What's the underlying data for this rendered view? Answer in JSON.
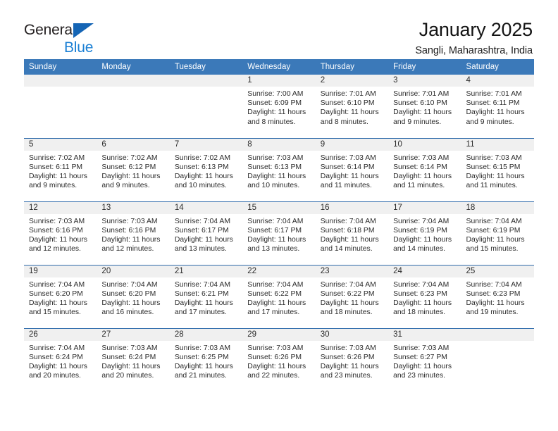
{
  "brand": {
    "name_part1": "General",
    "name_part2": "Blue",
    "accent_color": "#1a7fd4",
    "triangle_color": "#1565b5",
    "triangle_icon": "triangle-icon"
  },
  "header": {
    "title": "January 2025",
    "subtitle": "Sangli, Maharashtra, India"
  },
  "calendar": {
    "header_bg": "#3b79b9",
    "row_border_color": "#2f6bab",
    "daynum_band_bg": "#f0f0f0",
    "weekdays": [
      "Sunday",
      "Monday",
      "Tuesday",
      "Wednesday",
      "Thursday",
      "Friday",
      "Saturday"
    ],
    "weeks": [
      [
        {
          "day": "",
          "sunrise": "",
          "sunset": "",
          "daylight_line1": "",
          "daylight_line2": ""
        },
        {
          "day": "",
          "sunrise": "",
          "sunset": "",
          "daylight_line1": "",
          "daylight_line2": ""
        },
        {
          "day": "",
          "sunrise": "",
          "sunset": "",
          "daylight_line1": "",
          "daylight_line2": ""
        },
        {
          "day": "1",
          "sunrise": "Sunrise: 7:00 AM",
          "sunset": "Sunset: 6:09 PM",
          "daylight_line1": "Daylight: 11 hours",
          "daylight_line2": "and 8 minutes."
        },
        {
          "day": "2",
          "sunrise": "Sunrise: 7:01 AM",
          "sunset": "Sunset: 6:10 PM",
          "daylight_line1": "Daylight: 11 hours",
          "daylight_line2": "and 8 minutes."
        },
        {
          "day": "3",
          "sunrise": "Sunrise: 7:01 AM",
          "sunset": "Sunset: 6:10 PM",
          "daylight_line1": "Daylight: 11 hours",
          "daylight_line2": "and 9 minutes."
        },
        {
          "day": "4",
          "sunrise": "Sunrise: 7:01 AM",
          "sunset": "Sunset: 6:11 PM",
          "daylight_line1": "Daylight: 11 hours",
          "daylight_line2": "and 9 minutes."
        }
      ],
      [
        {
          "day": "5",
          "sunrise": "Sunrise: 7:02 AM",
          "sunset": "Sunset: 6:11 PM",
          "daylight_line1": "Daylight: 11 hours",
          "daylight_line2": "and 9 minutes."
        },
        {
          "day": "6",
          "sunrise": "Sunrise: 7:02 AM",
          "sunset": "Sunset: 6:12 PM",
          "daylight_line1": "Daylight: 11 hours",
          "daylight_line2": "and 9 minutes."
        },
        {
          "day": "7",
          "sunrise": "Sunrise: 7:02 AM",
          "sunset": "Sunset: 6:13 PM",
          "daylight_line1": "Daylight: 11 hours",
          "daylight_line2": "and 10 minutes."
        },
        {
          "day": "8",
          "sunrise": "Sunrise: 7:03 AM",
          "sunset": "Sunset: 6:13 PM",
          "daylight_line1": "Daylight: 11 hours",
          "daylight_line2": "and 10 minutes."
        },
        {
          "day": "9",
          "sunrise": "Sunrise: 7:03 AM",
          "sunset": "Sunset: 6:14 PM",
          "daylight_line1": "Daylight: 11 hours",
          "daylight_line2": "and 11 minutes."
        },
        {
          "day": "10",
          "sunrise": "Sunrise: 7:03 AM",
          "sunset": "Sunset: 6:14 PM",
          "daylight_line1": "Daylight: 11 hours",
          "daylight_line2": "and 11 minutes."
        },
        {
          "day": "11",
          "sunrise": "Sunrise: 7:03 AM",
          "sunset": "Sunset: 6:15 PM",
          "daylight_line1": "Daylight: 11 hours",
          "daylight_line2": "and 11 minutes."
        }
      ],
      [
        {
          "day": "12",
          "sunrise": "Sunrise: 7:03 AM",
          "sunset": "Sunset: 6:16 PM",
          "daylight_line1": "Daylight: 11 hours",
          "daylight_line2": "and 12 minutes."
        },
        {
          "day": "13",
          "sunrise": "Sunrise: 7:03 AM",
          "sunset": "Sunset: 6:16 PM",
          "daylight_line1": "Daylight: 11 hours",
          "daylight_line2": "and 12 minutes."
        },
        {
          "day": "14",
          "sunrise": "Sunrise: 7:04 AM",
          "sunset": "Sunset: 6:17 PM",
          "daylight_line1": "Daylight: 11 hours",
          "daylight_line2": "and 13 minutes."
        },
        {
          "day": "15",
          "sunrise": "Sunrise: 7:04 AM",
          "sunset": "Sunset: 6:17 PM",
          "daylight_line1": "Daylight: 11 hours",
          "daylight_line2": "and 13 minutes."
        },
        {
          "day": "16",
          "sunrise": "Sunrise: 7:04 AM",
          "sunset": "Sunset: 6:18 PM",
          "daylight_line1": "Daylight: 11 hours",
          "daylight_line2": "and 14 minutes."
        },
        {
          "day": "17",
          "sunrise": "Sunrise: 7:04 AM",
          "sunset": "Sunset: 6:19 PM",
          "daylight_line1": "Daylight: 11 hours",
          "daylight_line2": "and 14 minutes."
        },
        {
          "day": "18",
          "sunrise": "Sunrise: 7:04 AM",
          "sunset": "Sunset: 6:19 PM",
          "daylight_line1": "Daylight: 11 hours",
          "daylight_line2": "and 15 minutes."
        }
      ],
      [
        {
          "day": "19",
          "sunrise": "Sunrise: 7:04 AM",
          "sunset": "Sunset: 6:20 PM",
          "daylight_line1": "Daylight: 11 hours",
          "daylight_line2": "and 15 minutes."
        },
        {
          "day": "20",
          "sunrise": "Sunrise: 7:04 AM",
          "sunset": "Sunset: 6:20 PM",
          "daylight_line1": "Daylight: 11 hours",
          "daylight_line2": "and 16 minutes."
        },
        {
          "day": "21",
          "sunrise": "Sunrise: 7:04 AM",
          "sunset": "Sunset: 6:21 PM",
          "daylight_line1": "Daylight: 11 hours",
          "daylight_line2": "and 17 minutes."
        },
        {
          "day": "22",
          "sunrise": "Sunrise: 7:04 AM",
          "sunset": "Sunset: 6:22 PM",
          "daylight_line1": "Daylight: 11 hours",
          "daylight_line2": "and 17 minutes."
        },
        {
          "day": "23",
          "sunrise": "Sunrise: 7:04 AM",
          "sunset": "Sunset: 6:22 PM",
          "daylight_line1": "Daylight: 11 hours",
          "daylight_line2": "and 18 minutes."
        },
        {
          "day": "24",
          "sunrise": "Sunrise: 7:04 AM",
          "sunset": "Sunset: 6:23 PM",
          "daylight_line1": "Daylight: 11 hours",
          "daylight_line2": "and 18 minutes."
        },
        {
          "day": "25",
          "sunrise": "Sunrise: 7:04 AM",
          "sunset": "Sunset: 6:23 PM",
          "daylight_line1": "Daylight: 11 hours",
          "daylight_line2": "and 19 minutes."
        }
      ],
      [
        {
          "day": "26",
          "sunrise": "Sunrise: 7:04 AM",
          "sunset": "Sunset: 6:24 PM",
          "daylight_line1": "Daylight: 11 hours",
          "daylight_line2": "and 20 minutes."
        },
        {
          "day": "27",
          "sunrise": "Sunrise: 7:03 AM",
          "sunset": "Sunset: 6:24 PM",
          "daylight_line1": "Daylight: 11 hours",
          "daylight_line2": "and 20 minutes."
        },
        {
          "day": "28",
          "sunrise": "Sunrise: 7:03 AM",
          "sunset": "Sunset: 6:25 PM",
          "daylight_line1": "Daylight: 11 hours",
          "daylight_line2": "and 21 minutes."
        },
        {
          "day": "29",
          "sunrise": "Sunrise: 7:03 AM",
          "sunset": "Sunset: 6:26 PM",
          "daylight_line1": "Daylight: 11 hours",
          "daylight_line2": "and 22 minutes."
        },
        {
          "day": "30",
          "sunrise": "Sunrise: 7:03 AM",
          "sunset": "Sunset: 6:26 PM",
          "daylight_line1": "Daylight: 11 hours",
          "daylight_line2": "and 23 minutes."
        },
        {
          "day": "31",
          "sunrise": "Sunrise: 7:03 AM",
          "sunset": "Sunset: 6:27 PM",
          "daylight_line1": "Daylight: 11 hours",
          "daylight_line2": "and 23 minutes."
        },
        {
          "day": "",
          "sunrise": "",
          "sunset": "",
          "daylight_line1": "",
          "daylight_line2": ""
        }
      ]
    ]
  }
}
